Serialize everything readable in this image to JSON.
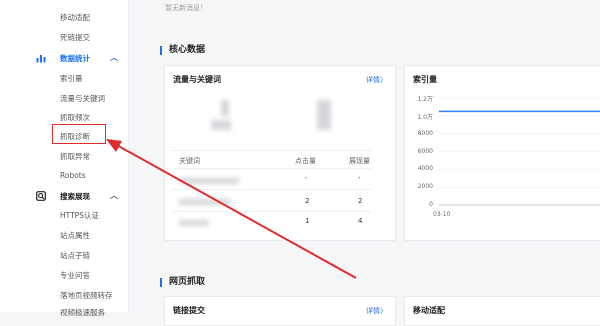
{
  "sidebar": {
    "items_top": [
      "移动适配",
      "死链提交"
    ],
    "group_stats": {
      "label": "数据统计",
      "chevron": "︿"
    },
    "items_stats": [
      "索引量",
      "流量与关键词",
      "抓取频次",
      "抓取诊断",
      "抓取异常",
      "Robots"
    ],
    "group_search": {
      "label": "搜索展现",
      "chevron": "︿"
    },
    "items_search": [
      "HTTPS认证",
      "站点属性",
      "站点子链",
      "专业问答",
      "落地页视频转存",
      "视频极速服务"
    ]
  },
  "main": {
    "message": "暂无新消息！",
    "section_core": "核心数据",
    "section_crawl": "网页抓取",
    "traffic_card": {
      "title": "流量与关键词",
      "link": "详情〉",
      "headers": [
        "关键词",
        "点击量",
        "展现量"
      ],
      "rows": [
        {
          "clicks": "-",
          "impressions": "-"
        },
        {
          "clicks": "2",
          "impressions": "2"
        },
        {
          "clicks": "1",
          "impressions": "4"
        }
      ]
    },
    "index_card": {
      "title": "索引量"
    },
    "link_submit_card": {
      "title": "链接提交",
      "link": "详情〉"
    },
    "mobile_card": {
      "title": "移动适配"
    }
  },
  "chart_data": {
    "type": "line",
    "title": "索引量",
    "x": [
      "03-10"
    ],
    "y_ticks": [
      "1.2万",
      "1.0万",
      "8000",
      "6000",
      "4000",
      "2000",
      "0"
    ],
    "ylim": [
      0,
      12000
    ],
    "series": [
      {
        "values": [
          10500,
          10500
        ]
      }
    ],
    "grid": true,
    "line_color": "#2f7ff5"
  },
  "colors": {
    "accent": "#1f6ff2",
    "annotation": "#e02b2b"
  },
  "icons": {
    "stats": "bar-chart-icon",
    "search": "search-display-icon"
  }
}
